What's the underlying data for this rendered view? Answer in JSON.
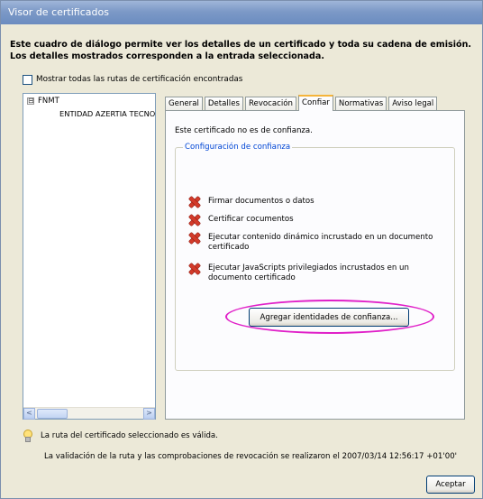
{
  "window": {
    "title": "Visor de certificados"
  },
  "intro": {
    "text": "Este cuadro de diálogo permite ver los detalles de un certificado y toda su cadena de emisión. Los detalles mostrados corresponden a la entrada seleccionada."
  },
  "show_all": {
    "label": "Mostrar todas las rutas de certificación encontradas",
    "checked": false
  },
  "tree": {
    "root": {
      "expander": "⊟",
      "label": "FNMT"
    },
    "child": {
      "label": "ENTIDAD AZERTIA TECNOLOGIAS"
    },
    "scroll_left": "<",
    "scroll_right": ">"
  },
  "tabs": [
    {
      "label": "General",
      "active": false
    },
    {
      "label": "Detalles",
      "active": false
    },
    {
      "label": "Revocación",
      "active": false
    },
    {
      "label": "Confiar",
      "active": true
    },
    {
      "label": "Normativas",
      "active": false
    },
    {
      "label": "Aviso legal",
      "active": false
    }
  ],
  "trust": {
    "status": "Este certificado no es de confianza.",
    "group_label": "Configuración de confianza",
    "permissions": [
      {
        "icon": "red-x-icon",
        "label": "Firmar documentos o datos"
      },
      {
        "icon": "red-x-icon",
        "label": "Certificar cocumentos"
      },
      {
        "icon": "red-x-icon",
        "label": "Ejecutar contenido dinámico incrustado en un documento certificado"
      },
      {
        "icon": "red-x-icon",
        "label": "Ejecutar JavaScripts privilegiados incrustados en un documento certificado"
      }
    ],
    "add_button": "Agregar identidades de confianza...",
    "highlight_color": "#e020c8"
  },
  "status": {
    "icon": "lightbulb-icon",
    "valid_text": "La ruta del certificado seleccionado es válida.",
    "validation_text": "La validación de la ruta y las comprobaciones de revocación se realizaron el 2007/03/14 12:56:17 +01'00'"
  },
  "footer": {
    "accept_button": "Aceptar"
  }
}
